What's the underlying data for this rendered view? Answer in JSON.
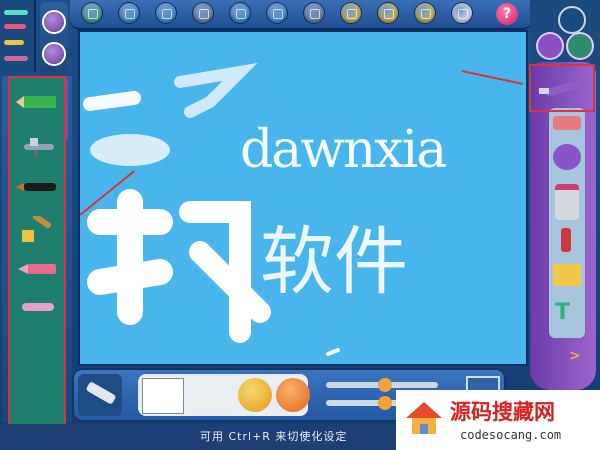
{
  "toolbar": {
    "buttons": [
      {
        "name": "new-icon",
        "color": "#2bb36f"
      },
      {
        "name": "open-icon",
        "color": "#2f8fd4"
      },
      {
        "name": "brush-icon",
        "color": "#2f8fd4"
      },
      {
        "name": "rotate-icon",
        "color": "#6b7f93"
      },
      {
        "name": "copy-icon",
        "color": "#2f8fd4"
      },
      {
        "name": "print-icon",
        "color": "#2f8fd4"
      },
      {
        "name": "book-icon",
        "color": "#6b7f93"
      },
      {
        "name": "check-icon",
        "color": "#f2c12d"
      },
      {
        "name": "close-icon",
        "color": "#f2c12d"
      },
      {
        "name": "frame-icon",
        "color": "#f2c12d"
      },
      {
        "name": "bulb-icon",
        "color": "#ffffff"
      },
      {
        "name": "help-icon",
        "color": "#e53a84"
      }
    ],
    "help_label": "?"
  },
  "canvas": {
    "text_latin": "dawnxia",
    "text_chinese": "软件"
  },
  "status": {
    "hint": "可用 Ctrl+R 来切使化设定"
  },
  "watermark": {
    "title": "源码搜藏网",
    "subtitle": "codesocang.com"
  },
  "colors": {
    "highlight": "#d8343a",
    "canvas": "#48b6ec",
    "panel_purple": "#7a4fb1"
  }
}
